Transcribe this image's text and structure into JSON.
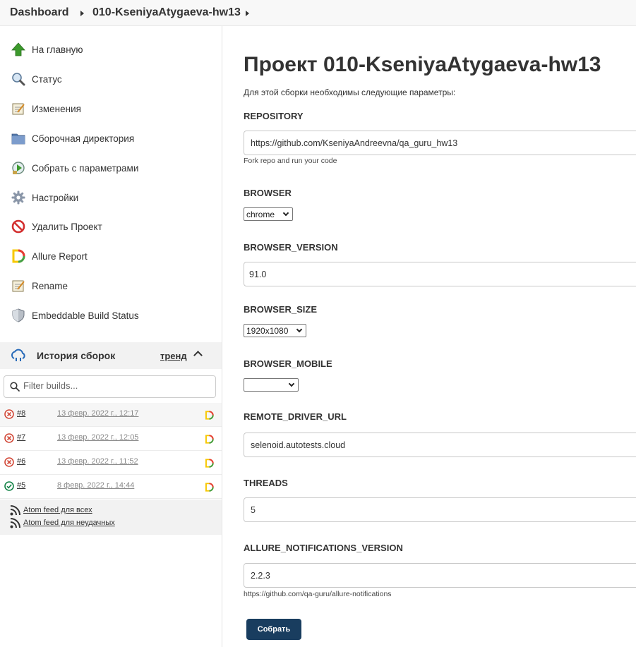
{
  "breadcrumb": {
    "items": [
      "Dashboard",
      "010-KseniyaAtygaeva-hw13"
    ]
  },
  "sidebar": {
    "tasks": [
      {
        "label": "На главную",
        "icon": "up-arrow-icon"
      },
      {
        "label": "Статус",
        "icon": "magnifier-icon"
      },
      {
        "label": "Изменения",
        "icon": "notepad-icon"
      },
      {
        "label": "Сборочная директория",
        "icon": "folder-icon"
      },
      {
        "label": "Собрать с параметрами",
        "icon": "build-clock-icon"
      },
      {
        "label": "Настройки",
        "icon": "gear-icon"
      },
      {
        "label": "Удалить Проект",
        "icon": "no-entry-icon"
      },
      {
        "label": "Allure Report",
        "icon": "allure-icon"
      },
      {
        "label": "Rename",
        "icon": "notepad-icon"
      },
      {
        "label": "Embeddable Build Status",
        "icon": "shield-icon"
      }
    ]
  },
  "history": {
    "title": "История сборок",
    "trend": "тренд",
    "filter_placeholder": "Filter builds...",
    "builds": [
      {
        "number": "#8",
        "date": "13 февр. 2022 г., 12:17",
        "status": "failed"
      },
      {
        "number": "#7",
        "date": "13 февр. 2022 г., 12:05",
        "status": "failed"
      },
      {
        "number": "#6",
        "date": "13 февр. 2022 г., 11:52",
        "status": "failed"
      },
      {
        "number": "#5",
        "date": "8 февр. 2022 г., 14:44",
        "status": "success"
      }
    ],
    "feeds": [
      "Atom feed для всех",
      "Atom feed для неудачных"
    ]
  },
  "main": {
    "title": "Проект 010-KseniyaAtygaeva-hw13",
    "description": "Для этой сборки необходимы следующие параметры:",
    "params": {
      "repository": {
        "name": "REPOSITORY",
        "value": "https://github.com/KseniyaAndreevna/qa_guru_hw13",
        "help": "Fork repo and run your code"
      },
      "browser": {
        "name": "BROWSER",
        "value": "chrome"
      },
      "browser_version": {
        "name": "BROWSER_VERSION",
        "value": "91.0"
      },
      "browser_size": {
        "name": "BROWSER_SIZE",
        "value": "1920x1080"
      },
      "browser_mobile": {
        "name": "BROWSER_MOBILE",
        "value": ""
      },
      "remote_driver_url": {
        "name": "REMOTE_DRIVER_URL",
        "value": "selenoid.autotests.cloud"
      },
      "threads": {
        "name": "THREADS",
        "value": "5"
      },
      "allure_notifications_version": {
        "name": "ALLURE_NOTIFICATIONS_VERSION",
        "value": "2.2.3",
        "help": "https://github.com/qa-guru/allure-notifications"
      }
    },
    "submit_label": "Собрать"
  },
  "colors": {
    "accent": "#193d5f",
    "failed": "#d24939",
    "success": "#138347"
  }
}
